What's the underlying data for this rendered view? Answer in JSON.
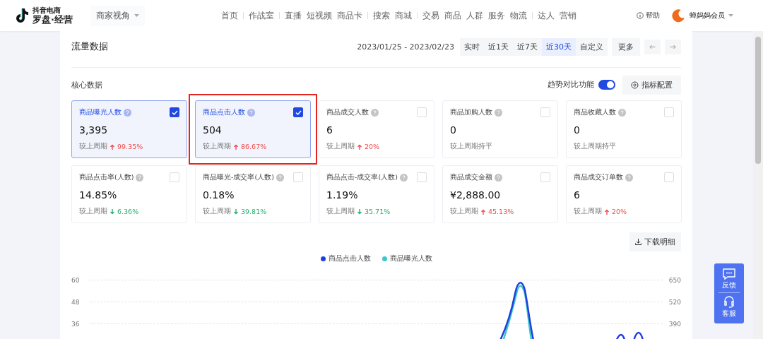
{
  "header": {
    "logo_small": "抖音电商",
    "logo_main": "罗盘·经营",
    "perspective": "商家视角",
    "nav": [
      {
        "label": "首页",
        "divider_after": true
      },
      {
        "label": "作战室",
        "divider_after": true
      },
      {
        "label": "直播",
        "divider_after": false
      },
      {
        "label": "短视频",
        "divider_after": false
      },
      {
        "label": "商品卡",
        "divider_after": true
      },
      {
        "label": "搜索",
        "divider_after": false
      },
      {
        "label": "商城",
        "divider_after": true
      },
      {
        "label": "交易",
        "divider_after": false
      },
      {
        "label": "商品",
        "divider_after": false
      },
      {
        "label": "人群",
        "divider_after": false
      },
      {
        "label": "服务",
        "divider_after": false
      },
      {
        "label": "物流",
        "divider_after": true
      },
      {
        "label": "达人",
        "divider_after": false
      },
      {
        "label": "营销",
        "divider_after": false
      }
    ],
    "help": "帮助",
    "account": "蝉妈妈会员"
  },
  "section": {
    "title": "流量数据",
    "date_range": "2023/01/25 - 2023/02/23",
    "periods": [
      {
        "label": "实时",
        "selected": false
      },
      {
        "label": "近1天",
        "selected": false
      },
      {
        "label": "近7天",
        "selected": false
      },
      {
        "label": "近30天",
        "selected": true
      },
      {
        "label": "自定义",
        "selected": false
      }
    ],
    "more": "更多"
  },
  "core": {
    "title": "核心数据",
    "trend_label": "趋势对比功能",
    "trend_on": true,
    "config_button": "指标配置",
    "metrics": [
      {
        "name": "商品曝光人数",
        "value": "3,395",
        "compare": "较上周期",
        "kind": "up",
        "change": "99.35%",
        "checked": true,
        "highlighted": false
      },
      {
        "name": "商品点击人数",
        "value": "504",
        "compare": "较上周期",
        "kind": "up",
        "change": "86.67%",
        "checked": true,
        "highlighted": true
      },
      {
        "name": "商品成交人数",
        "value": "6",
        "compare": "较上周期",
        "kind": "up",
        "change": "20%",
        "checked": false,
        "highlighted": false
      },
      {
        "name": "商品加购人数",
        "value": "0",
        "compare": "较上周期持平",
        "kind": "flat",
        "checked": false,
        "highlighted": false
      },
      {
        "name": "商品收藏人数",
        "value": "0",
        "compare": "较上周期持平",
        "kind": "flat",
        "checked": false,
        "highlighted": false
      },
      {
        "name": "商品点击率(人数)",
        "value": "14.85%",
        "compare": "较上周期",
        "kind": "down",
        "change": "6.36%",
        "checked": false,
        "highlighted": false
      },
      {
        "name": "商品曝光-成交率(人数)",
        "value": "0.18%",
        "compare": "较上周期",
        "kind": "down",
        "change": "39.81%",
        "checked": false,
        "highlighted": false
      },
      {
        "name": "商品点击-成交率(人数)",
        "value": "1.19%",
        "compare": "较上周期",
        "kind": "down",
        "change": "35.71%",
        "checked": false,
        "highlighted": false
      },
      {
        "name": "商品成交金额",
        "value": "¥2,888.00",
        "compare": "较上周期",
        "kind": "up",
        "change": "45.13%",
        "checked": false,
        "highlighted": false
      },
      {
        "name": "商品成交订单数",
        "value": "6",
        "compare": "较上周期",
        "kind": "up",
        "change": "20%",
        "checked": false,
        "highlighted": false
      }
    ]
  },
  "download": "下载明细",
  "chart": {
    "legend": [
      {
        "name": "商品点击人数",
        "color": "#1f3fe0"
      },
      {
        "name": "商品曝光人数",
        "color": "#3cc8c8"
      }
    ],
    "left_ticks": [
      "60",
      "48",
      "36"
    ],
    "right_ticks": [
      "650",
      "520",
      "390"
    ]
  },
  "float": [
    {
      "label": "反馈",
      "kind": "feedback"
    },
    {
      "label": "客服",
      "kind": "service"
    }
  ]
}
